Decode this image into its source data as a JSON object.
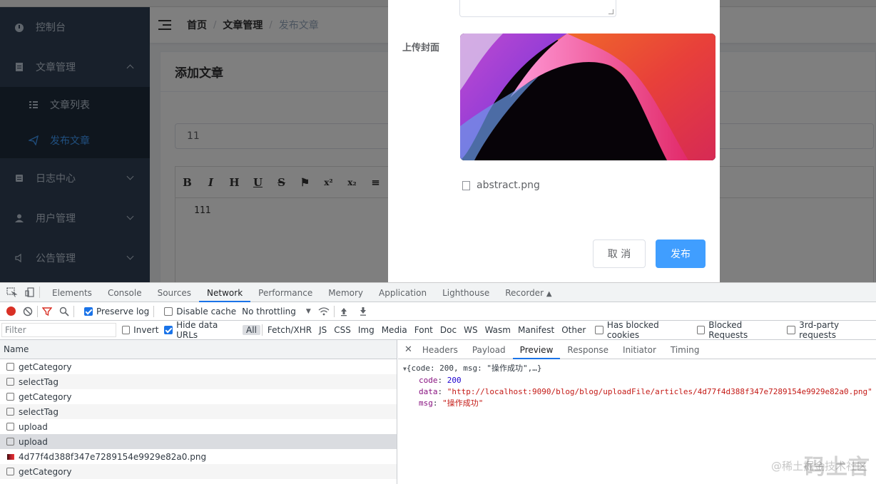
{
  "sidebar": {
    "items": [
      {
        "label": "控制台",
        "icon": "dashboard-icon"
      },
      {
        "label": "文章管理",
        "icon": "document-icon"
      },
      {
        "label": "文章列表",
        "icon": "list-icon"
      },
      {
        "label": "发布文章",
        "icon": "send-icon"
      },
      {
        "label": "日志中心",
        "icon": "log-icon"
      },
      {
        "label": "用户管理",
        "icon": "user-icon"
      },
      {
        "label": "公告管理",
        "icon": "speaker-icon"
      }
    ]
  },
  "breadcrumb": {
    "home": "首页",
    "section": "文章管理",
    "current": "发布文章",
    "sep": "/"
  },
  "card": {
    "title": "添加文章",
    "title_input_value": "11",
    "editor_text": "111"
  },
  "editor_toolbar": [
    "B",
    "I",
    "H",
    "U",
    "S",
    "⚑",
    "x²",
    "x₂",
    "≡"
  ],
  "dialog": {
    "cover_label": "上传封面",
    "file_name": "abstract.png",
    "cancel_label": "取 消",
    "publish_label": "发布"
  },
  "devtools": {
    "tabs": [
      "Elements",
      "Console",
      "Sources",
      "Network",
      "Performance",
      "Memory",
      "Application",
      "Lighthouse",
      "Recorder"
    ],
    "active_tab": "Network",
    "preserve_log": "Preserve log",
    "disable_cache": "Disable cache",
    "throttling": "No throttling",
    "filter_placeholder": "Filter",
    "invert": "Invert",
    "hide_data_urls": "Hide data URLs",
    "type_filters": [
      "All",
      "Fetch/XHR",
      "JS",
      "CSS",
      "Img",
      "Media",
      "Font",
      "Doc",
      "WS",
      "Wasm",
      "Manifest",
      "Other"
    ],
    "blocked_cookies": "Has blocked cookies",
    "blocked_requests": "Blocked Requests",
    "third_party": "3rd-party requests",
    "name_header": "Name",
    "requests": [
      "getCategory",
      "selectTag",
      "getCategory",
      "selectTag",
      "upload",
      "upload",
      "4d77f4d388f347e7289154e9929e82a0.png",
      "getCategory"
    ],
    "detail_tabs": [
      "Headers",
      "Payload",
      "Preview",
      "Response",
      "Initiator",
      "Timing"
    ],
    "active_detail_tab": "Preview",
    "preview": {
      "summary": "{code: 200, msg: \"操作成功\",…}",
      "code_key": "code",
      "code_val": "200",
      "data_key": "data",
      "data_val": "\"http://localhost:9090/blog/blog/uploadFile/articles/4d77f4d388f347e7289154e9929e82a0.png\"",
      "msg_key": "msg",
      "msg_val": "\"操作成功\""
    }
  },
  "watermark": "@稀土掘金技术社区",
  "watermark_logo": "码上言",
  "colors": {
    "primary": "#409eff",
    "sidebar_bg": "#304156",
    "devtools_accent": "#1a73e8"
  }
}
